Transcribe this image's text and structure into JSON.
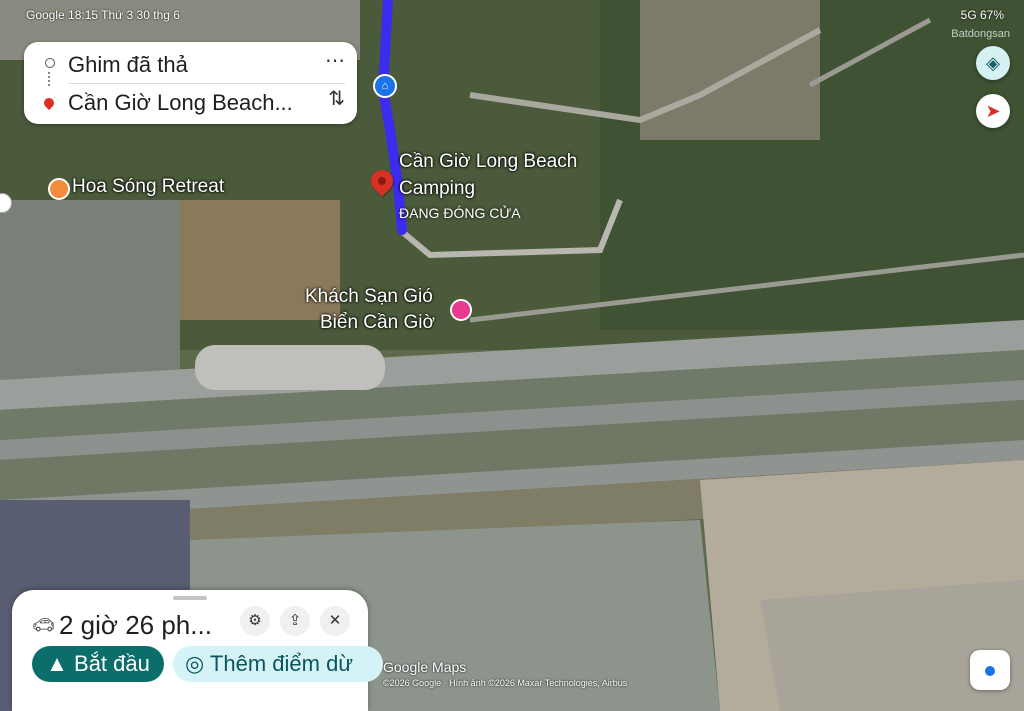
{
  "status_bar": {
    "left": "Google 18:15 Thứ 3 30 thg 6",
    "right": "5G 67%"
  },
  "watermark": "Batdongsan",
  "route_card": {
    "origin": "Ghim đã thả",
    "destination": "Cần Giờ Long Beach...",
    "more_icon": "more-icon",
    "swap_icon": "swap-icon"
  },
  "map": {
    "places": {
      "hoa_song": "Hoa Sóng Retreat",
      "long_beach_line1": "Cần Giờ Long Beach",
      "long_beach_line2": "Camping",
      "long_beach_status": "ĐANG ĐÓNG CỬA",
      "khach_san_line1": "Khách Sạn Gió",
      "khach_san_line2": "Biển Cần Giờ"
    },
    "brand": "Google Maps",
    "copyright": "©2026 Google · Hình ảnh ©2026 Maxar Technologies, Airbus",
    "route_color": "#3b2cf0"
  },
  "bottom_sheet": {
    "duration": "2 giờ 26 ph...",
    "start_label": "Bắt đầu",
    "add_stop_label": "Thêm điểm dừ",
    "filter_icon": "filter-icon",
    "share_icon": "share-icon",
    "close_icon": "close-icon"
  },
  "colors": {
    "accent": "#0b6e6b",
    "pin": "#d93025"
  }
}
